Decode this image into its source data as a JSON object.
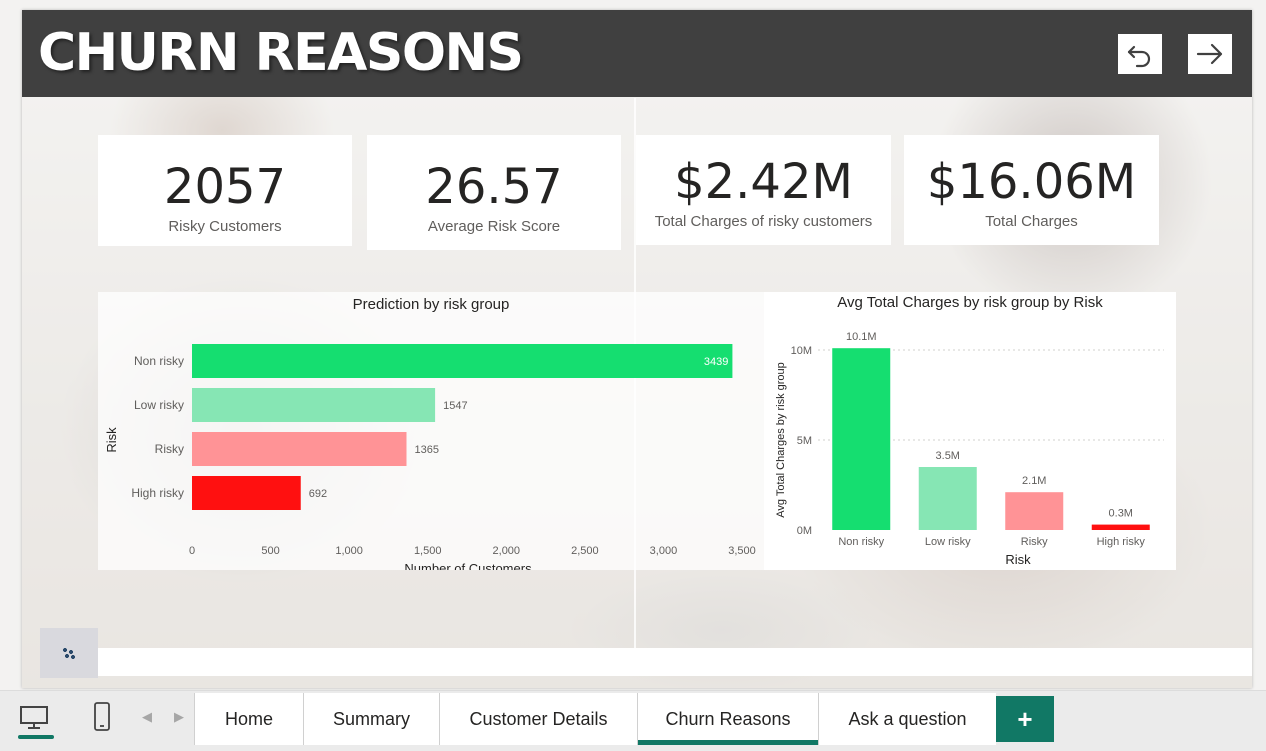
{
  "header": {
    "title": "CHURN REASONS"
  },
  "nav": {
    "back_icon": "undo-arrow-icon",
    "forward_icon": "right-arrow-icon"
  },
  "cards": [
    {
      "value": "2057",
      "label": "Risky Customers"
    },
    {
      "value": "26.57",
      "label": "Average Risk Score"
    },
    {
      "value": "$2.42M",
      "label": "Total Charges of risky customers"
    },
    {
      "value": "$16.06M",
      "label": "Total Charges"
    }
  ],
  "colors": {
    "header_bg": "#404040",
    "non_risky": "#15de70",
    "low_risky": "#86e6b4",
    "risky": "#ff9396",
    "high_risky": "#ff1010",
    "accent": "#117865"
  },
  "chart_data": [
    {
      "type": "bar",
      "orientation": "horizontal",
      "title": "Prediction by risk group",
      "xlabel": "Number of Customers",
      "ylabel": "Risk",
      "categories": [
        "Non risky",
        "Low risky",
        "Risky",
        "High risky"
      ],
      "values": [
        3439,
        1547,
        1365,
        692
      ],
      "value_labels": [
        "3439",
        "1547",
        "1365",
        "692"
      ],
      "xlim": [
        0,
        3500
      ],
      "xticks": [
        0,
        500,
        1000,
        1500,
        2000,
        2500,
        3000,
        3500
      ],
      "xtick_labels": [
        "0",
        "500",
        "1,000",
        "1,500",
        "2,000",
        "2,500",
        "3,000",
        "3,500"
      ],
      "grid": false
    },
    {
      "type": "bar",
      "orientation": "vertical",
      "title": "Avg Total Charges by risk group by Risk",
      "xlabel": "Risk",
      "ylabel": "Avg Total Charges by risk group",
      "categories": [
        "Non risky",
        "Low risky",
        "Risky",
        "High risky"
      ],
      "values": [
        10.1,
        3.5,
        2.1,
        0.3
      ],
      "value_units": "M",
      "value_labels": [
        "10.1M",
        "3.5M",
        "2.1M",
        "0.3M"
      ],
      "ylim": [
        0,
        10
      ],
      "yticks": [
        0,
        5,
        10
      ],
      "ytick_labels": [
        "0M",
        "5M",
        "10M"
      ],
      "grid": true
    }
  ],
  "tabbar": {
    "desktop_icon": "desktop-icon",
    "phone_icon": "phone-icon",
    "prev_icon": "chevron-left-icon",
    "next_icon": "chevron-right-icon",
    "prev_glyph": "◀",
    "next_glyph": "▶",
    "tabs": [
      {
        "label": "Home",
        "active": false
      },
      {
        "label": "Summary",
        "active": false
      },
      {
        "label": "Customer Details",
        "active": false
      },
      {
        "label": "Churn Reasons",
        "active": true
      },
      {
        "label": "Ask a question",
        "active": false
      }
    ],
    "add_label": "+"
  }
}
